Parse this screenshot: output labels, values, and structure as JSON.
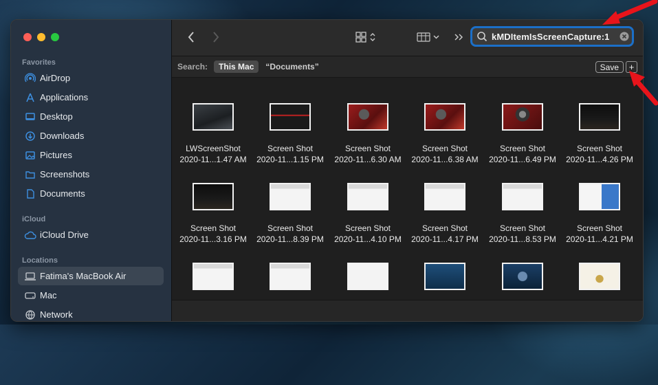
{
  "sidebar": {
    "favorites_title": "Favorites",
    "favorites": [
      {
        "label": "AirDrop",
        "icon": "airdrop-icon"
      },
      {
        "label": "Applications",
        "icon": "applications-icon"
      },
      {
        "label": "Desktop",
        "icon": "desktop-icon"
      },
      {
        "label": "Downloads",
        "icon": "downloads-icon"
      },
      {
        "label": "Pictures",
        "icon": "pictures-icon"
      },
      {
        "label": "Screenshots",
        "icon": "folder-icon"
      },
      {
        "label": "Documents",
        "icon": "document-icon"
      }
    ],
    "icloud_title": "iCloud",
    "icloud": [
      {
        "label": "iCloud Drive",
        "icon": "cloud-icon"
      }
    ],
    "locations_title": "Locations",
    "locations": [
      {
        "label": "Fatima's MacBook Air",
        "icon": "laptop-icon",
        "selected": true
      },
      {
        "label": "Mac",
        "icon": "disk-icon"
      },
      {
        "label": "Network",
        "icon": "network-icon"
      }
    ]
  },
  "search": {
    "query": "kMDItemIsScreenCapture:1"
  },
  "scope": {
    "label": "Search:",
    "this_mac": "This Mac",
    "documents": "“Documents”",
    "save": "Save",
    "add": "+"
  },
  "files": [
    {
      "line1": "LWScreenShot",
      "line2": "2020-11...1.47 AM",
      "thumb": "dark"
    },
    {
      "line1": "Screen Shot",
      "line2": "2020-11...1.15 PM",
      "thumb": "darkred"
    },
    {
      "line1": "Screen Shot",
      "line2": "2020-11...6.30 AM",
      "thumb": "red"
    },
    {
      "line1": "Screen Shot",
      "line2": "2020-11...6.38 AM",
      "thumb": "red"
    },
    {
      "line1": "Screen Shot",
      "line2": "2020-11...6.49 PM",
      "thumb": "redicon"
    },
    {
      "line1": "Screen Shot",
      "line2": "2020-11...4.26 PM",
      "thumb": "black"
    },
    {
      "line1": "Screen Shot",
      "line2": "2020-11...3.16 PM",
      "thumb": "black"
    },
    {
      "line1": "Screen Shot",
      "line2": "2020-11...8.39 PM",
      "thumb": "doc"
    },
    {
      "line1": "Screen Shot",
      "line2": "2020-11...4.10 PM",
      "thumb": "doc"
    },
    {
      "line1": "Screen Shot",
      "line2": "2020-11...4.17 PM",
      "thumb": "doc"
    },
    {
      "line1": "Screen Shot",
      "line2": "2020-11...8.53 PM",
      "thumb": "doc"
    },
    {
      "line1": "Screen Shot",
      "line2": "2020-11...4.21 PM",
      "thumb": "blueimg"
    },
    {
      "line1": "",
      "line2": "",
      "thumb": "doc"
    },
    {
      "line1": "",
      "line2": "",
      "thumb": "doc"
    },
    {
      "line1": "",
      "line2": "",
      "thumb": "white"
    },
    {
      "line1": "",
      "line2": "",
      "thumb": "bluedesk"
    },
    {
      "line1": "",
      "line2": "",
      "thumb": "bluedesk2"
    },
    {
      "line1": "",
      "line2": "",
      "thumb": "whiteimg"
    }
  ],
  "colors": {
    "accent": "#1b6fc8",
    "annotation_arrow": "#e8141b"
  }
}
